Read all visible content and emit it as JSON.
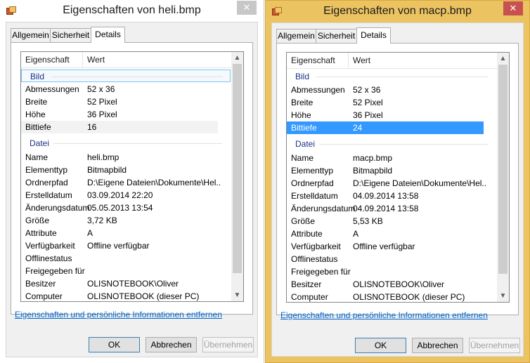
{
  "colors": {
    "selection": "#3399ff",
    "group_text": "#1e3287",
    "active_frame": "#ecc361",
    "close_active": "#c75050"
  },
  "icons": {
    "app": "bitmap-file-icon",
    "close": "close-icon"
  },
  "windows": [
    {
      "title": "Eigenschaften von heli.bmp",
      "close_glyph": "✕",
      "tabs": [
        "Allgemein",
        "Sicherheit",
        "Details"
      ],
      "columns": [
        "Eigenschaft",
        "Wert"
      ],
      "groups": [
        "Bild",
        "Datei"
      ],
      "image_rows": [
        {
          "k": "Abmessungen",
          "v": "52 x 36"
        },
        {
          "k": "Breite",
          "v": "52 Pixel"
        },
        {
          "k": "Höhe",
          "v": "36 Pixel"
        },
        {
          "k": "Bittiefe",
          "v": "16"
        }
      ],
      "file_rows": [
        {
          "k": "Name",
          "v": "heli.bmp"
        },
        {
          "k": "Elementtyp",
          "v": "Bitmapbild"
        },
        {
          "k": "Ordnerpfad",
          "v": "D:\\Eigene Dateien\\Dokumente\\Hel..."
        },
        {
          "k": "Erstelldatum",
          "v": "03.09.2014 22:20"
        },
        {
          "k": "Änderungsdatum",
          "v": "05.05.2013 13:54"
        },
        {
          "k": "Größe",
          "v": "3,72 KB"
        },
        {
          "k": "Attribute",
          "v": "A"
        },
        {
          "k": "Verfügbarkeit",
          "v": "Offline verfügbar"
        },
        {
          "k": "Offlinestatus",
          "v": ""
        },
        {
          "k": "Freigegeben für",
          "v": ""
        },
        {
          "k": "Besitzer",
          "v": "OLISNOTEBOOK\\Oliver"
        },
        {
          "k": "Computer",
          "v": "OLISNOTEBOOK (dieser PC)"
        }
      ],
      "link": "Eigenschaften und persönliche Informationen entfernen",
      "buttons": [
        "OK",
        "Abbrechen",
        "Übernehmen"
      ]
    },
    {
      "title": "Eigenschaften von macp.bmp",
      "close_glyph": "✕",
      "tabs": [
        "Allgemein",
        "Sicherheit",
        "Details"
      ],
      "columns": [
        "Eigenschaft",
        "Wert"
      ],
      "groups": [
        "Bild",
        "Datei"
      ],
      "image_rows": [
        {
          "k": "Abmessungen",
          "v": "52 x 36"
        },
        {
          "k": "Breite",
          "v": "52 Pixel"
        },
        {
          "k": "Höhe",
          "v": "36 Pixel"
        },
        {
          "k": "Bittiefe",
          "v": "24"
        }
      ],
      "file_rows": [
        {
          "k": "Name",
          "v": "macp.bmp"
        },
        {
          "k": "Elementtyp",
          "v": "Bitmapbild"
        },
        {
          "k": "Ordnerpfad",
          "v": "D:\\Eigene Dateien\\Dokumente\\Hel..."
        },
        {
          "k": "Erstelldatum",
          "v": "04.09.2014 13:58"
        },
        {
          "k": "Änderungsdatum",
          "v": "04.09.2014 13:58"
        },
        {
          "k": "Größe",
          "v": "5,53 KB"
        },
        {
          "k": "Attribute",
          "v": "A"
        },
        {
          "k": "Verfügbarkeit",
          "v": "Offline verfügbar"
        },
        {
          "k": "Offlinestatus",
          "v": ""
        },
        {
          "k": "Freigegeben für",
          "v": ""
        },
        {
          "k": "Besitzer",
          "v": "OLISNOTEBOOK\\Oliver"
        },
        {
          "k": "Computer",
          "v": "OLISNOTEBOOK (dieser PC)"
        }
      ],
      "link": "Eigenschaften und persönliche Informationen entfernen",
      "buttons": [
        "OK",
        "Abbrechen",
        "Übernehmen"
      ]
    }
  ]
}
